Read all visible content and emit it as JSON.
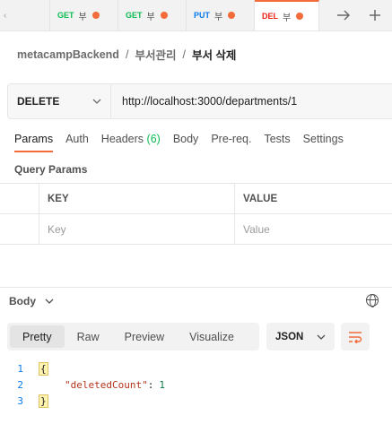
{
  "tabs": {
    "first_label": "‹",
    "items": [
      {
        "method": "GET",
        "name": "부"
      },
      {
        "method": "GET",
        "name": "부"
      },
      {
        "method": "PUT",
        "name": "부"
      },
      {
        "method": "DEL",
        "name": "부"
      }
    ],
    "forward_icon": "arrow-right-icon",
    "add_icon": "plus-icon"
  },
  "breadcrumb": {
    "collection": "metacampBackend",
    "folder": "부서관리",
    "request": "부서 삭제"
  },
  "request": {
    "method": "DELETE",
    "url": "http://localhost:3000/departments/1"
  },
  "request_tabs": {
    "params": "Params",
    "auth": "Auth",
    "headers": "Headers",
    "headers_count": "(6)",
    "body": "Body",
    "prereq": "Pre-req.",
    "tests": "Tests",
    "settings": "Settings"
  },
  "query_params": {
    "title": "Query Params",
    "col_key": "KEY",
    "col_value": "VALUE",
    "key_placeholder": "Key",
    "value_placeholder": "Value"
  },
  "response": {
    "label": "Body",
    "view_tabs": [
      "Pretty",
      "Raw",
      "Preview",
      "Visualize"
    ],
    "format": "JSON",
    "lines": [
      {
        "num": "1",
        "text": "{"
      },
      {
        "num": "2",
        "key": "\"deletedCount\"",
        "colon": ":",
        "value": "1"
      },
      {
        "num": "3",
        "text": "}"
      }
    ]
  },
  "colors": {
    "accent": "#f26b3a",
    "get": "#0cbb52",
    "put": "#097bed",
    "delete": "#eb2013"
  }
}
